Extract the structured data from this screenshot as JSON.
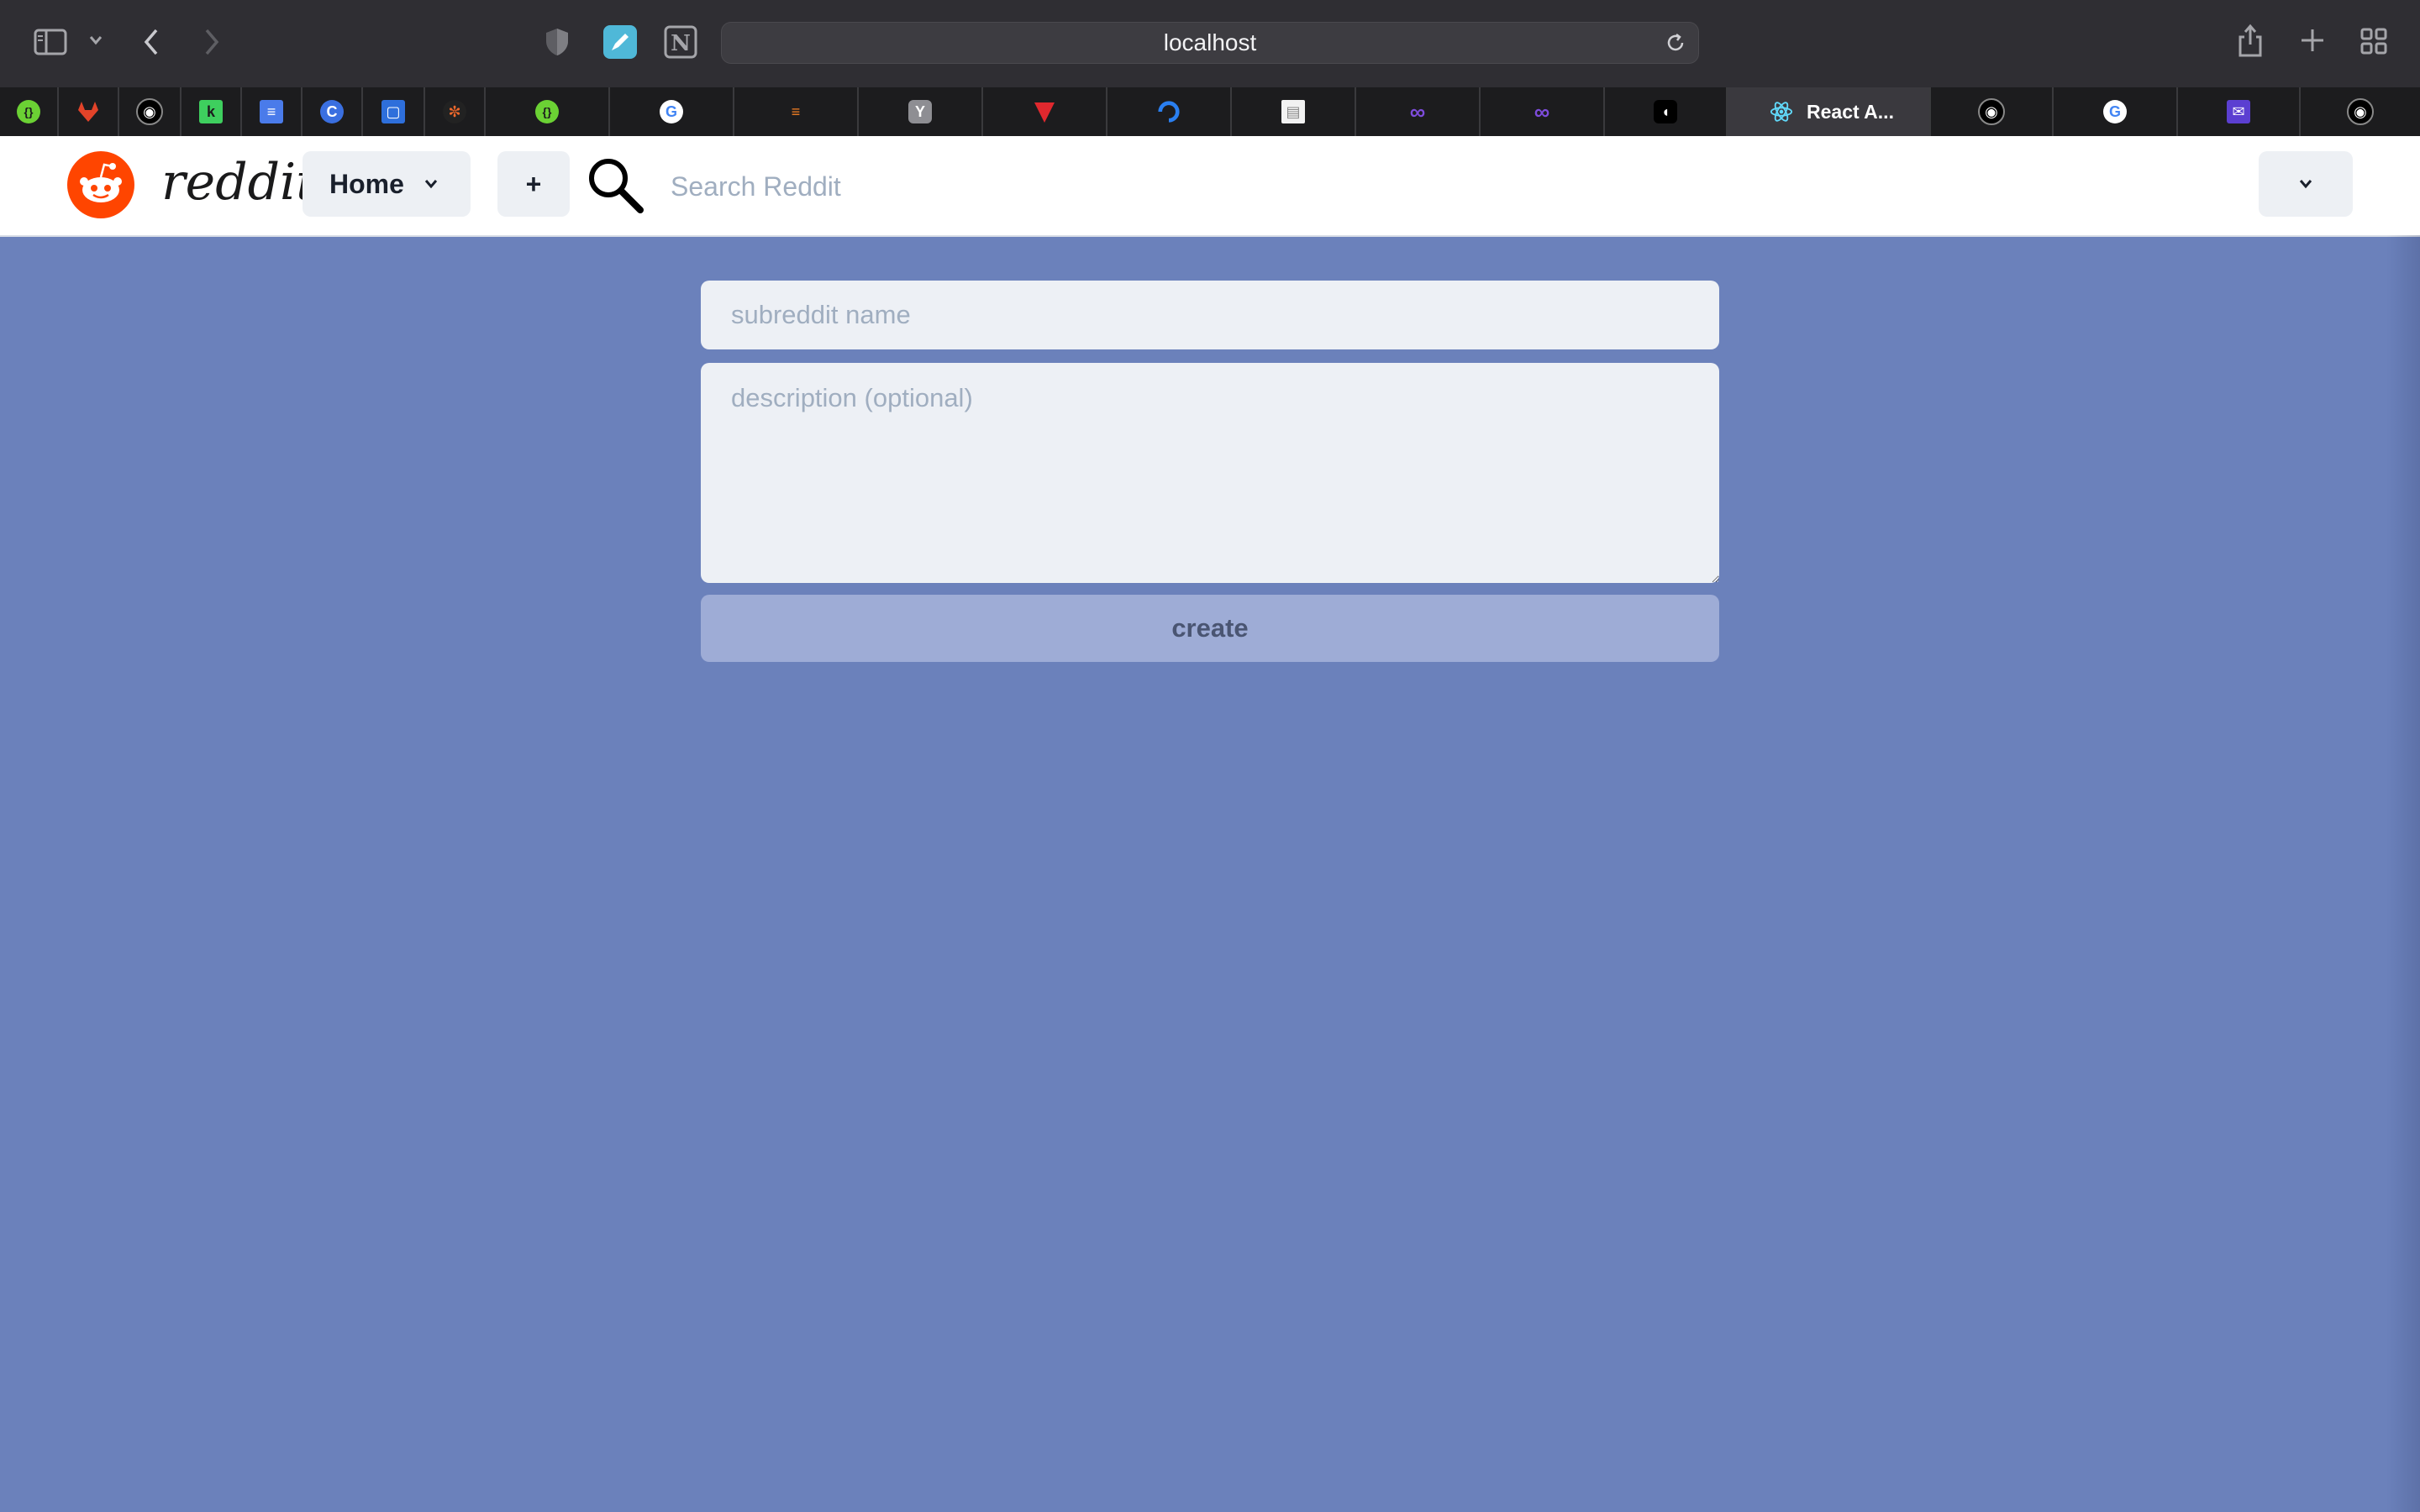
{
  "browser": {
    "url": "localhost",
    "active_tab_title": "React A...",
    "tab_favicons": [
      "graphql-icon",
      "gitlab-icon",
      "github-icon",
      "codeforces-icon",
      "docs-icon",
      "c-icon",
      "frame-icon",
      "swirl-icon",
      "graphql-icon",
      "google-icon",
      "stackoverflow-icon",
      "y-icon",
      "vitest-icon",
      "digitalocean-icon",
      "archive-icon",
      "apollo-icon",
      "apollo-icon",
      "dark-icon",
      "react-icon",
      "github-icon",
      "google-icon",
      "mail-icon",
      "github-icon"
    ],
    "tab_letters": {
      "y": "Y",
      "notion": "N"
    }
  },
  "header": {
    "wordmark": "reddit",
    "home_label": "Home",
    "plus_label": "+",
    "search_placeholder": "Search Reddit"
  },
  "form": {
    "name_placeholder": "subreddit name",
    "description_placeholder": "description (optional)",
    "create_label": "create"
  },
  "colors": {
    "background": "#6b81bb",
    "brand": "#ff4500",
    "field": "#edf0f5",
    "button": "#9eacd6"
  }
}
